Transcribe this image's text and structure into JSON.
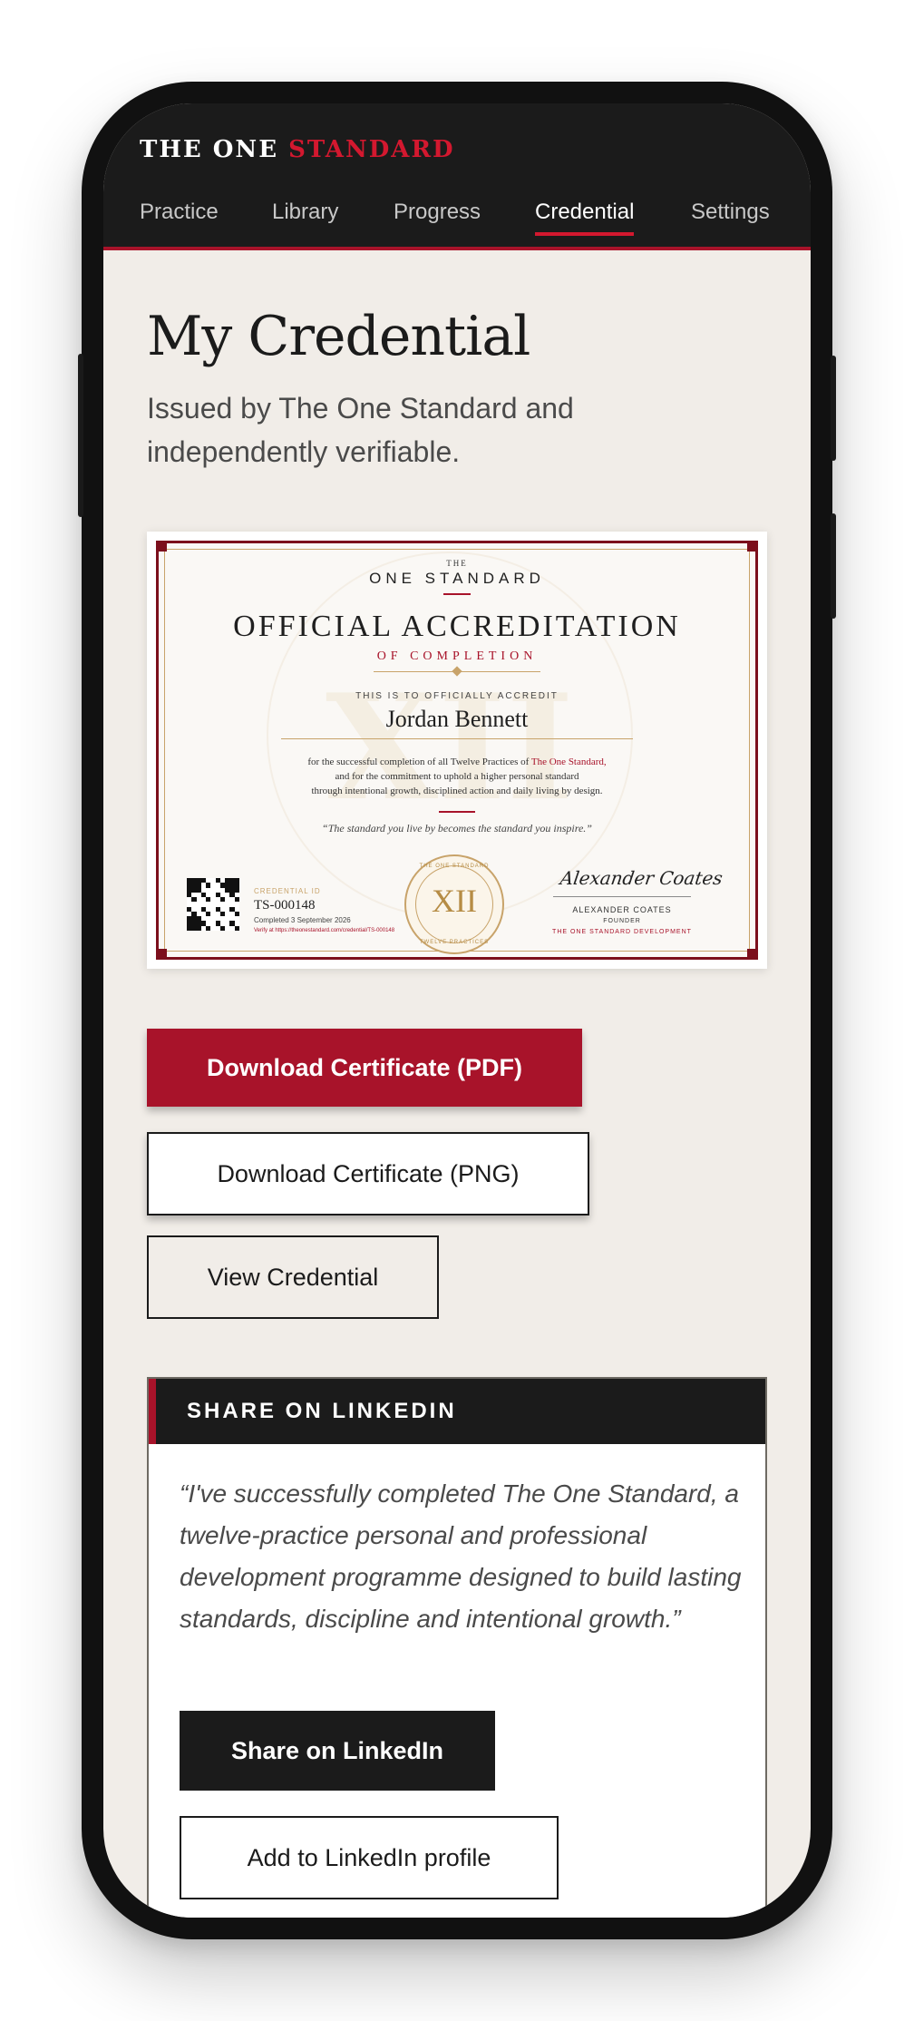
{
  "header": {
    "brand_primary": "THE ONE",
    "brand_accent": "STANDARD",
    "nav": [
      {
        "label": "Practice"
      },
      {
        "label": "Library"
      },
      {
        "label": "Progress"
      },
      {
        "label": "Credential",
        "active": true
      },
      {
        "label": "Settings"
      }
    ]
  },
  "page": {
    "title": "My Credential",
    "subtitle": "Issued by The One Standard and independently verifiable."
  },
  "certificate": {
    "the": "THE",
    "brand": "ONE STANDARD",
    "heading": "OFFICIAL ACCREDITATION",
    "subheading": "OF COMPLETION",
    "intro": "THIS IS TO OFFICIALLY ACCREDIT",
    "recipient": "Jordan Bennett",
    "body_line1_start": "for the successful completion of all Twelve Practices of ",
    "body_line1_link": "The One Standard,",
    "body_line2": "and for the commitment to uphold a higher personal standard",
    "body_line3": "through intentional growth, disciplined action and daily living by design.",
    "quote": "“The standard you live by becomes the standard you inspire.”",
    "watermark": "XII",
    "credential_label": "CREDENTIAL ID",
    "credential_id": "TS-000148",
    "completed": "Completed 3 September 2026",
    "verify": "Verify at https://theonestandard.com/credential/TS-000148",
    "seal_top": "THE ONE STANDARD",
    "seal_numeral": "XII",
    "seal_bottom": "TWELVE PRACTICES",
    "signature": "Alexander Coates",
    "signer_name": "ALEXANDER COATES",
    "signer_title": "FOUNDER",
    "signer_org": "THE ONE STANDARD DEVELOPMENT"
  },
  "actions": {
    "download_pdf": "Download Certificate (PDF)",
    "download_png": "Download Certificate (PNG)",
    "view_credential": "View Credential"
  },
  "linkedin": {
    "heading": "SHARE ON LINKEDIN",
    "message": "“I've successfully completed The One Standard, a twelve-practice personal and professional development programme designed to build lasting standards, discipline and intentional growth.”",
    "share_button": "Share on LinkedIn",
    "add_profile_button": "Add to LinkedIn profile"
  },
  "colors": {
    "accent_red": "#a8132a",
    "header_dark": "#1b1b1b",
    "page_background": "#f1ede8",
    "gold": "#c8a36a"
  }
}
